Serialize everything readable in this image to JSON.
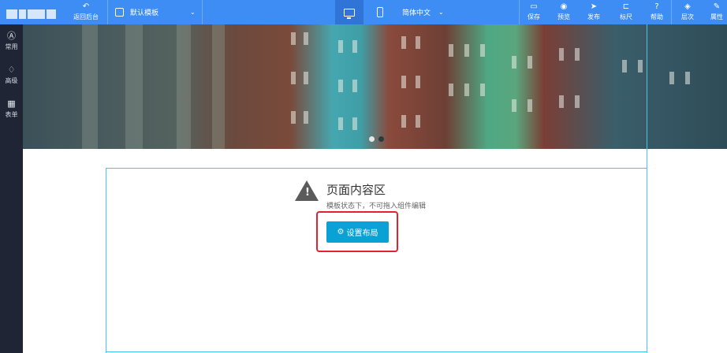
{
  "topbar": {
    "back_label": "返回后台",
    "template_label": "默认模板",
    "language_label": "简体中文",
    "actions": [
      {
        "label": "保存",
        "icon": "save-icon"
      },
      {
        "label": "预览",
        "icon": "eye-icon"
      },
      {
        "label": "发布",
        "icon": "send-icon"
      },
      {
        "label": "标尺",
        "icon": "ruler-icon"
      },
      {
        "label": "帮助",
        "icon": "help-icon"
      },
      {
        "label": "层次",
        "icon": "layers-icon"
      },
      {
        "label": "属性",
        "icon": "brush-icon"
      }
    ]
  },
  "sidebar": {
    "items": [
      {
        "label": "常用",
        "icon": "letter-a-icon"
      },
      {
        "label": "高级",
        "icon": "diamond-icon"
      },
      {
        "label": "表单",
        "icon": "grid-icon"
      }
    ]
  },
  "content": {
    "title": "页面内容区",
    "subtitle": "模板状态下，不可拖入组件编辑",
    "button_label": "设置布局"
  },
  "colors": {
    "topbar": "#3d8df5",
    "sidebar": "#1f2535",
    "button": "#0aa2d4",
    "highlight": "#e0232e"
  }
}
